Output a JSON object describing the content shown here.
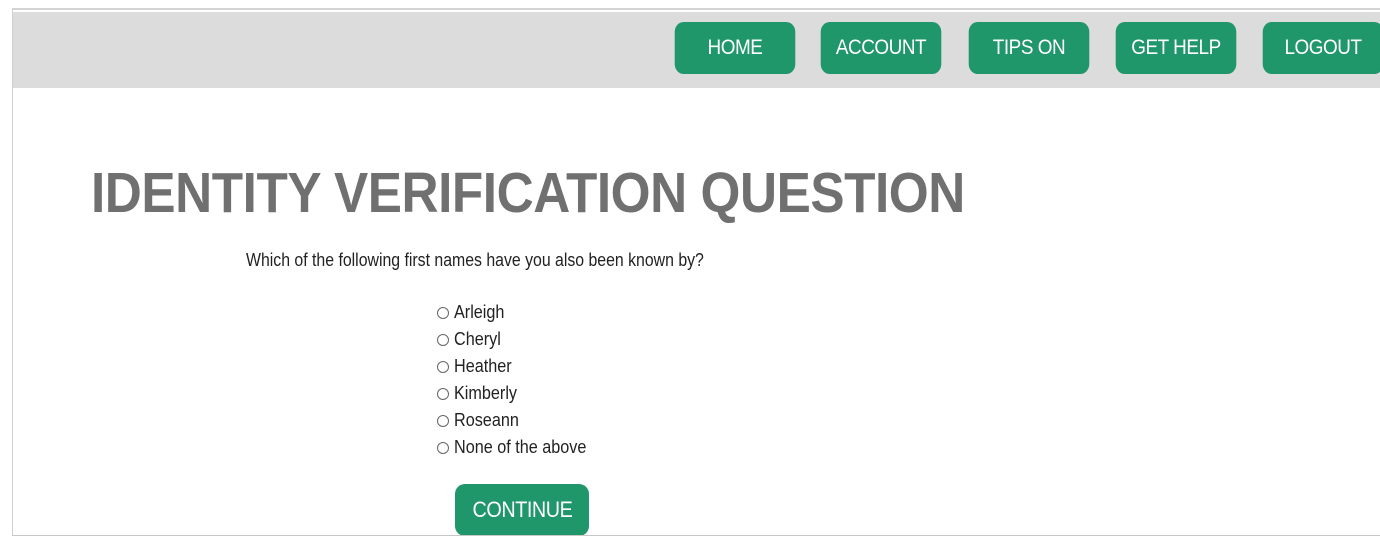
{
  "nav": {
    "home": "HOME",
    "account": "ACCOUNT",
    "tips": "TIPS ON",
    "help": "GET HELP",
    "logout": "LOGOUT"
  },
  "page": {
    "title": "IDENTITY VERIFICATION QUESTION",
    "question": "Which of the following first names have you also been known by?"
  },
  "options": [
    "Arleigh",
    "Cheryl",
    "Heather",
    "Kimberly",
    "Roseann",
    "None of the above"
  ],
  "actions": {
    "continue": "CONTINUE"
  },
  "colors": {
    "accent": "#20966b",
    "topbar": "#dcdcdc",
    "title": "#707070"
  }
}
